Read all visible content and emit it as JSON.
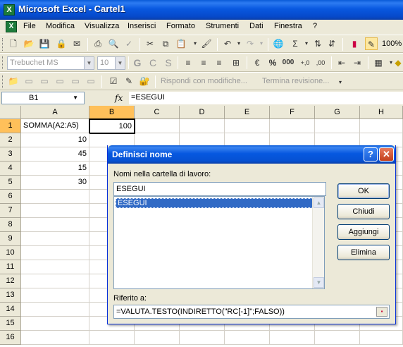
{
  "window": {
    "title": "Microsoft Excel - Cartel1"
  },
  "menu": [
    "File",
    "Modifica",
    "Visualizza",
    "Inserisci",
    "Formato",
    "Strumenti",
    "Dati",
    "Finestra",
    "?"
  ],
  "toolbar1": {
    "zoom": "100%"
  },
  "toolbar2": {
    "font": "Trebuchet MS",
    "size": "10",
    "bold": "G",
    "italic": "C",
    "underline": "S",
    "percent": "%",
    "thousands": "000"
  },
  "toolbar3": {
    "reply": "Rispondi con modifiche...",
    "end_review": "Termina revisione..."
  },
  "formula_bar": {
    "name_box": "B1",
    "fx": "fx",
    "formula": "=ESEGUI"
  },
  "grid": {
    "columns": [
      "A",
      "B",
      "C",
      "D",
      "E",
      "F",
      "G",
      "H"
    ],
    "rows": [
      "1",
      "2",
      "3",
      "4",
      "5",
      "6",
      "7",
      "8",
      "9",
      "10",
      "11",
      "12",
      "13",
      "14",
      "15",
      "16"
    ],
    "a_values": [
      "SOMMA(A2:A5)",
      "10",
      "45",
      "15",
      "30"
    ],
    "b1_value": "100"
  },
  "dialog": {
    "title": "Definisci nome",
    "names_label": "Nomi nella cartella di lavoro:",
    "name_value": "ESEGUI",
    "list_items": [
      "ESEGUI"
    ],
    "ref_label": "Riferito a:",
    "ref_value": "=VALUTA.TESTO(INDIRETTO(\"RC[-1]\";FALSO))",
    "ok": "OK",
    "close": "Chiudi",
    "add": "Aggiungi",
    "delete": "Elimina"
  }
}
